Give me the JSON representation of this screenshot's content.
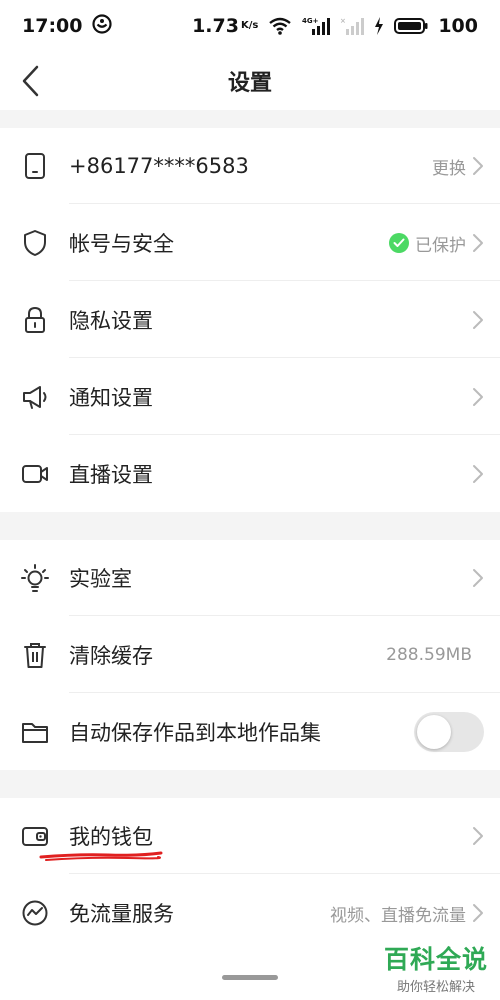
{
  "status_bar": {
    "time": "17:00",
    "speed": "1.73",
    "speed_unit": "K/s",
    "battery": "100"
  },
  "nav": {
    "title": "设置"
  },
  "sections": {
    "account": [
      {
        "label": "+86177****6583",
        "right_text": "更换",
        "icon": "phone-icon"
      },
      {
        "label": "帐号与安全",
        "right_text": "已保护",
        "icon": "shield-icon",
        "status_color": "#4cd964"
      },
      {
        "label": "隐私设置",
        "right_text": "",
        "icon": "lock-icon"
      },
      {
        "label": "通知设置",
        "right_text": "",
        "icon": "megaphone-icon"
      },
      {
        "label": "直播设置",
        "right_text": "",
        "icon": "video-camera-icon"
      }
    ],
    "general": [
      {
        "label": "实验室",
        "right_text": "",
        "icon": "lightbulb-icon"
      },
      {
        "label": "清除缓存",
        "right_text": "288.59MB",
        "icon": "trash-icon"
      },
      {
        "label": "自动保存作品到本地作品集",
        "toggle_on": false,
        "icon": "folder-icon"
      }
    ],
    "wallet": [
      {
        "label": "我的钱包",
        "right_text": "",
        "icon": "wallet-icon"
      },
      {
        "label": "免流量服务",
        "right_text": "视频、直播免流量",
        "icon": "data-flow-icon"
      }
    ]
  },
  "watermark": {
    "brand": "百科全说",
    "tagline": "助你轻松解决"
  },
  "colors": {
    "accent_green": "#4cd964",
    "annotation_red": "#e02020",
    "section_gap": "#f4f4f4"
  }
}
